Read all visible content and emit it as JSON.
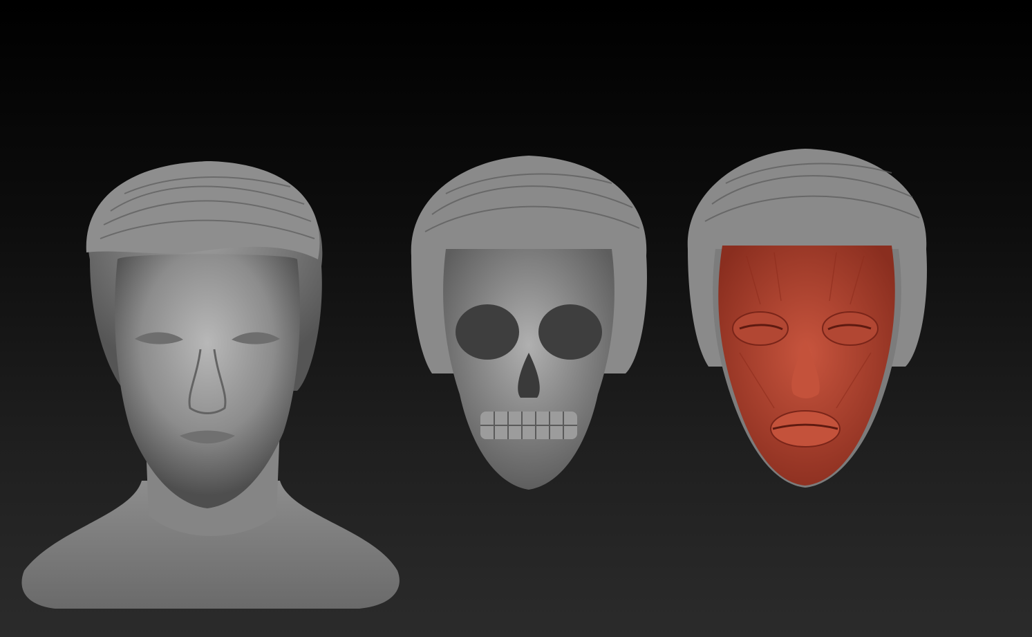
{
  "canvas": {
    "background_top": "#000000",
    "background_bottom": "#2b2b2b"
  },
  "models": [
    {
      "name": "head-bust",
      "material": "gray-clay",
      "color": "#8a8a8a"
    },
    {
      "name": "skull",
      "material": "gray-clay",
      "color": "#8a8a8a"
    },
    {
      "name": "facial-muscles",
      "material": "red-muscle",
      "color": "#b4432f"
    }
  ]
}
